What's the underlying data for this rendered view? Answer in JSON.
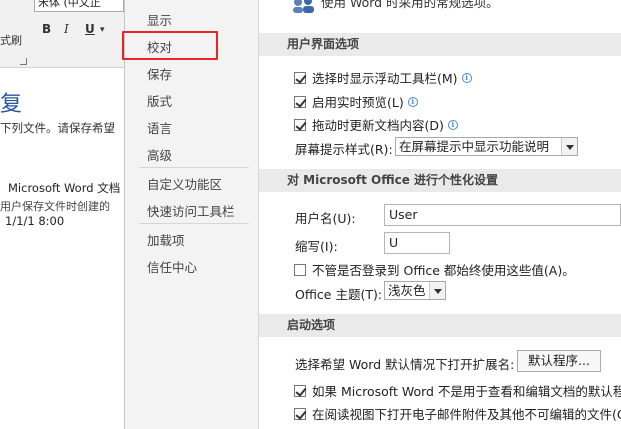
{
  "document": {
    "font_name": "宋体 (中文正",
    "format_buttons": {
      "bold": "B",
      "italic": "I",
      "underline": "U",
      "underline_caret": "▾"
    },
    "clear_format_label": "式刷",
    "recovery_title": "复",
    "recovery_desc": "下列文件。请保存希望",
    "recovery_item": {
      "name": "Microsoft Word 文档",
      "desc": "用户保存文件时创建的",
      "time": "1/1/1 8:00"
    }
  },
  "nav": {
    "items": [
      "显示",
      "校对",
      "保存",
      "版式",
      "语言",
      "高级",
      "自定义功能区",
      "快速访问工具栏",
      "加载项",
      "信任中心"
    ]
  },
  "content": {
    "intro_text": "使用 Word 时采用的常规选项。",
    "ui_section": {
      "header": "用户界面选项",
      "opt_minitoolbar": "选择时显示浮动工具栏(M)",
      "opt_livepreview": "启用实时预览(L)",
      "opt_dragupdate": "拖动时更新文档内容(D)",
      "tooltip_label": "屏幕提示样式(R):",
      "tooltip_value": "在屏幕提示中显示功能说明"
    },
    "personalize_section": {
      "header": "对 Microsoft Office 进行个性化设置",
      "username_label": "用户名(U):",
      "username_value": "User",
      "initials_label": "缩写(I):",
      "initials_value": "U",
      "always_use_label": "不管是否登录到 Office 都始终使用这些值(A)。",
      "theme_label": "Office 主题(T):",
      "theme_value": "浅灰色"
    },
    "startup_section": {
      "header": "启动选项",
      "default_programs_label": "选择希望 Word 默认情况下打开扩展名:",
      "default_programs_button": "默认程序...",
      "opt_tell_default": "如果 Microsoft Word 不是用于查看和编辑文档的默认程",
      "opt_email_reading": "在阅读视图下打开电子邮件附件及其他不可编辑的文件(O)"
    }
  }
}
